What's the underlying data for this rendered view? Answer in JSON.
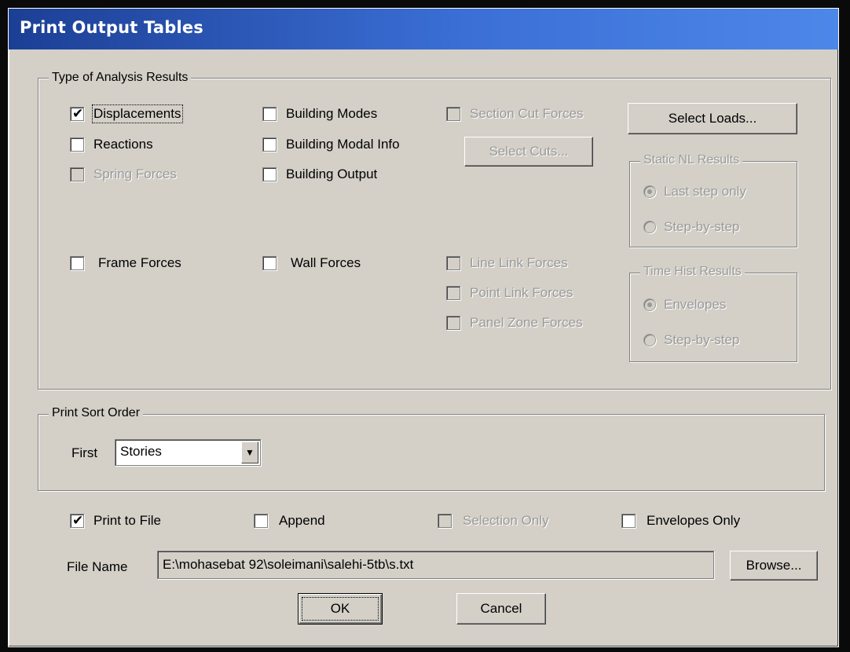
{
  "window": {
    "title": "Print Output Tables"
  },
  "analysis_group": {
    "legend": "Type of Analysis Results",
    "displacements": {
      "label": "Displacements",
      "checked": true
    },
    "reactions": {
      "label": "Reactions",
      "checked": false
    },
    "spring_forces": {
      "label": "Spring Forces",
      "checked": false,
      "enabled": false
    },
    "building_modes": {
      "label": "Building Modes",
      "checked": false
    },
    "building_modal_info": {
      "label": "Building Modal Info",
      "checked": false
    },
    "building_output": {
      "label": "Building Output",
      "checked": false
    },
    "section_cut_forces": {
      "label": "Section Cut Forces",
      "checked": false,
      "enabled": false
    },
    "select_cuts_label": "Select Cuts...",
    "select_loads_label": "Select Loads...",
    "frame_forces": {
      "label": "Frame Forces",
      "checked": false
    },
    "wall_forces": {
      "label": "Wall Forces",
      "checked": false
    },
    "line_link_forces": {
      "label": "Line Link Forces",
      "checked": false,
      "enabled": false
    },
    "point_link_forces": {
      "label": "Point Link Forces",
      "checked": false,
      "enabled": false
    },
    "panel_zone_forces": {
      "label": "Panel Zone Forces",
      "checked": false,
      "enabled": false
    },
    "static_nl": {
      "legend": "Static NL Results",
      "options": [
        "Last step only",
        "Step-by-step"
      ],
      "selected": "Last step only"
    },
    "time_hist": {
      "legend": "Time Hist Results",
      "options": [
        "Envelopes",
        "Step-by-step"
      ],
      "selected": "Envelopes"
    }
  },
  "sort_group": {
    "legend": "Print Sort Order",
    "first_label": "First",
    "first_value": "Stories"
  },
  "options": {
    "print_to_file": {
      "label": "Print to File",
      "checked": true
    },
    "append": {
      "label": "Append",
      "checked": false
    },
    "selection_only": {
      "label": "Selection Only",
      "checked": false,
      "enabled": false
    },
    "envelopes_only": {
      "label": "Envelopes Only",
      "checked": false
    }
  },
  "file": {
    "label": "File Name",
    "value": "E:\\mohasebat 92\\soleimani\\salehi-5tb\\s.txt",
    "browse_label": "Browse..."
  },
  "buttons": {
    "ok": "OK",
    "cancel": "Cancel"
  }
}
